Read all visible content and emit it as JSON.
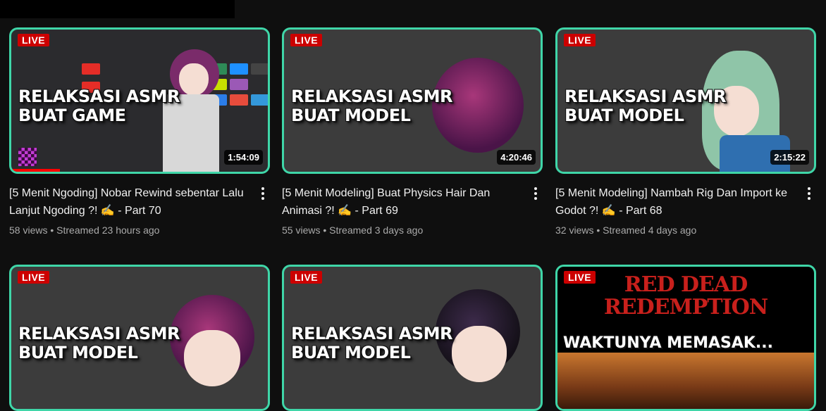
{
  "videos": [
    {
      "badge": "LIVE",
      "thumb_text": "RELAKSASI ASMR\nBUAT GAME",
      "duration": "1:54:09",
      "title": "[5 Menit Ngoding] Nobar Rewind sebentar Lalu Lanjut Ngoding ?! ✍️ - Part 70",
      "views": "58 views",
      "streamed": "Streamed 23 hours ago",
      "watched_fraction": 0.19
    },
    {
      "badge": "LIVE",
      "thumb_text": "RELAKSASI ASMR\nBUAT MODEL",
      "duration": "4:20:46",
      "title": "[5 Menit Modeling] Buat Physics Hair Dan Animasi ?! ✍️ - Part 69",
      "views": "55 views",
      "streamed": "Streamed 3 days ago"
    },
    {
      "badge": "LIVE",
      "thumb_text": "RELAKSASI ASMR\nBUAT MODEL",
      "duration": "2:15:22",
      "title": "[5 Menit Modeling] Nambah Rig Dan Import ke Godot ?! ✍️ - Part 68",
      "views": "32 views",
      "streamed": "Streamed 4 days ago"
    },
    {
      "badge": "LIVE",
      "thumb_text": "RELAKSASI ASMR\nBUAT MODEL"
    },
    {
      "badge": "LIVE",
      "thumb_text": "RELAKSASI ASMR\nBUAT MODEL"
    },
    {
      "badge": "LIVE",
      "thumb_title": "RED DEAD\nREDEMPTION",
      "thumb_text": "WAKTUNYA MEMASAK..."
    }
  ],
  "meta_separator": "•",
  "colors": {
    "background": "#0f0f0f",
    "live_badge": "#cc0000",
    "thumbnail_border": "#3fd6a8",
    "progress": "#ff0000",
    "secondary_text": "#aaaaaa"
  },
  "icons": {
    "menu": "more-vert-icon"
  }
}
